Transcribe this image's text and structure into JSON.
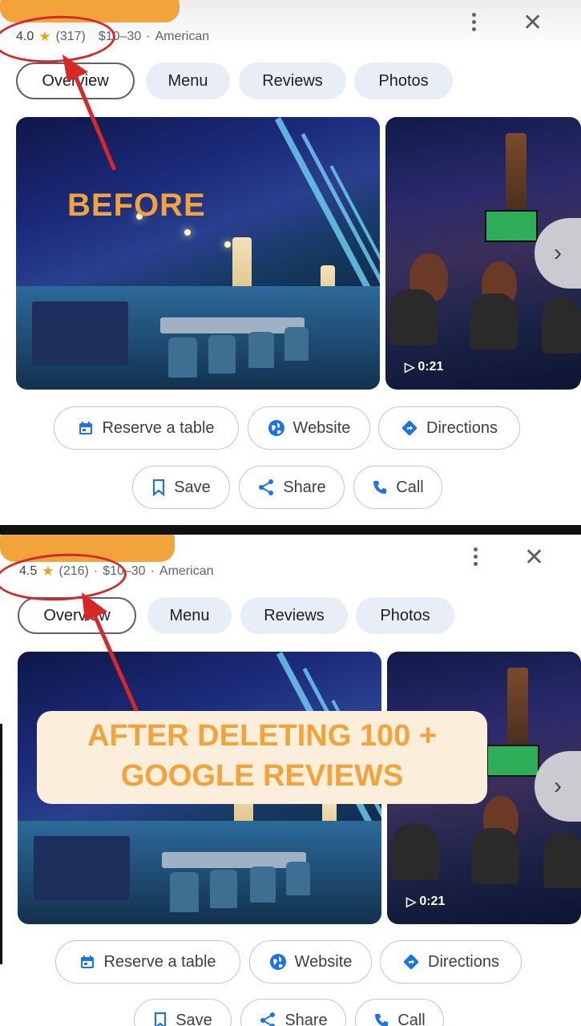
{
  "before": {
    "rating": "4.0",
    "reviews_count": "(317)",
    "price": "$10–30",
    "separator": "·",
    "cuisine": "American",
    "overlay_label": "BEFORE",
    "tabs": [
      "Overview",
      "Menu",
      "Reviews",
      "Photos"
    ],
    "video_duration": "0:21",
    "actions_row1": [
      "Reserve a table",
      "Website",
      "Directions"
    ],
    "actions_row2": [
      "Save",
      "Share",
      "Call"
    ]
  },
  "after": {
    "rating": "4.5",
    "reviews_count": "(216)",
    "price": "$10–30",
    "separator": "·",
    "cuisine": "American",
    "overlay_line1": "AFTER DELETING 100 +",
    "overlay_line2": "GOOGLE REVIEWS",
    "tabs": [
      "Overview",
      "Menu",
      "Reviews",
      "Photos"
    ],
    "video_duration": "0:21",
    "actions_row1": [
      "Reserve a table",
      "Website",
      "Directions"
    ],
    "actions_row2": [
      "Save",
      "Share",
      "Call"
    ]
  },
  "icons": {
    "star": "★",
    "close": "✕",
    "next": "›",
    "play": "▷"
  },
  "colors": {
    "annotation_orange": "#f2a33c",
    "annotation_red": "#d62828",
    "google_blue": "#1a73e8",
    "star_yellow": "#e8a317"
  }
}
